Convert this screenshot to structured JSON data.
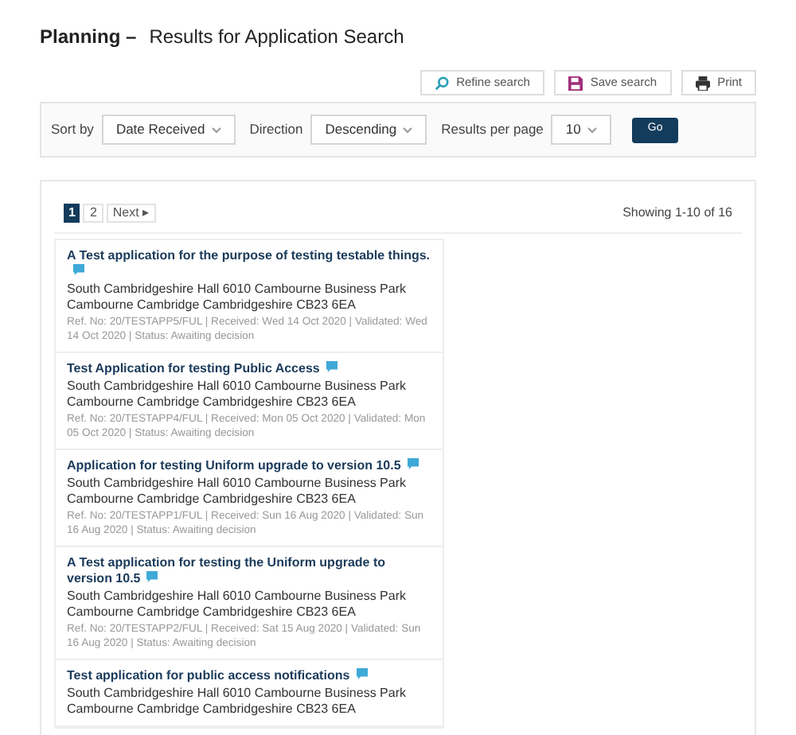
{
  "heading": {
    "section": "Planning –",
    "title": "Results for Application Search"
  },
  "actions": [
    {
      "kind": "search",
      "label": "Refine search"
    },
    {
      "kind": "save",
      "label": "Save search"
    },
    {
      "kind": "print",
      "label": "Print"
    }
  ],
  "sort": {
    "sort_label": "Sort by",
    "sort_value": "Date Received",
    "direction_label": "Direction",
    "direction_value": "Descending",
    "per_page_label": "Results per page",
    "per_page_value": "10",
    "go": "Go"
  },
  "pagination": {
    "pages": [
      {
        "label": "1",
        "selected": true
      },
      {
        "label": "2",
        "selected": false
      }
    ],
    "next": "Next",
    "next_arrow": "▸",
    "summary": "Showing 1-10 of 16"
  },
  "results": [
    {
      "title": "A Test application for the purpose of testing testable things.",
      "address": "South Cambridgeshire Hall 6010 Cambourne Business Park Cambourne Cambridge Cambridgeshire CB23 6EA",
      "meta": "Ref. No: 20/TESTAPP5/FUL | Received: Wed 14 Oct 2020 | Validated: Wed 14 Oct 2020 | Status: Awaiting decision"
    },
    {
      "title": "Test Application for testing Public Access",
      "address": "South Cambridgeshire Hall 6010 Cambourne Business Park Cambourne Cambridge Cambridgeshire CB23 6EA",
      "meta": "Ref. No: 20/TESTAPP4/FUL | Received: Mon 05 Oct 2020 | Validated: Mon 05 Oct 2020 | Status: Awaiting decision"
    },
    {
      "title": "Application for testing Uniform upgrade to version 10.5",
      "address": "South Cambridgeshire Hall 6010 Cambourne Business Park Cambourne Cambridge Cambridgeshire CB23 6EA",
      "meta": "Ref. No: 20/TESTAPP1/FUL | Received: Sun 16 Aug 2020 | Validated: Sun 16 Aug 2020 | Status: Awaiting decision"
    },
    {
      "title": "A Test application for testing the Uniform upgrade to version 10.5",
      "address": "South Cambridgeshire Hall 6010 Cambourne Business Park Cambourne Cambridge Cambridgeshire CB23 6EA",
      "meta": "Ref. No: 20/TESTAPP2/FUL | Received: Sat 15 Aug 2020 | Validated: Sun 16 Aug 2020 | Status: Awaiting decision"
    },
    {
      "title": "Test application for public access notifications",
      "address": "South Cambridgeshire Hall 6010 Cambourne Business Park Cambourne Cambridge Cambridgeshire CB23 6EA"
    }
  ]
}
